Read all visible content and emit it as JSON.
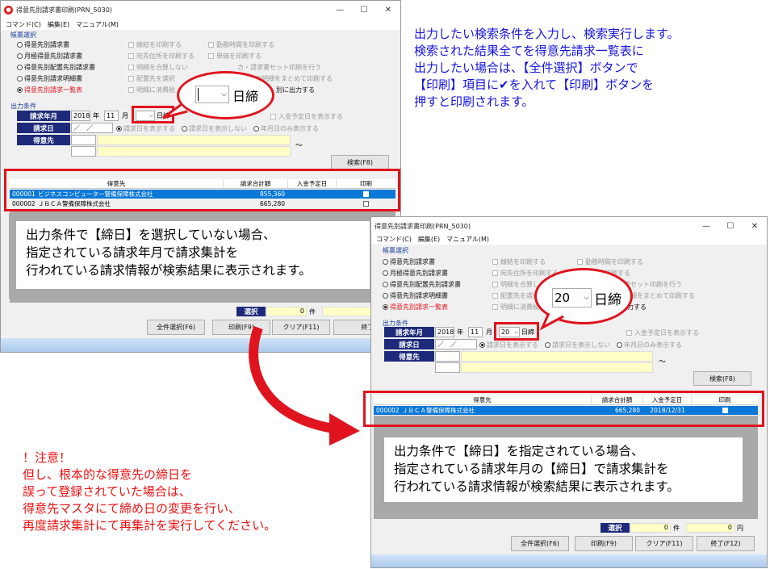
{
  "window": {
    "title": "得意先別請求書印刷(PRN_5030)",
    "menu": [
      "コマンド(C)",
      "編集(E)",
      "マニュアル(M)"
    ],
    "controls": [
      "—",
      "☐",
      "✕"
    ]
  },
  "report_group": {
    "label": "帳票選択",
    "options": [
      "得意先別請求書",
      "月極得意先別請求書",
      "得意先別配置先別請求書",
      "得意先別請求明細書",
      "得意先別請求一覧表"
    ],
    "checks_col1": [
      "線結を印刷する",
      "宛先住所を印刷する",
      "明細を合算しない",
      "配置先を選択",
      "明細に消費税"
    ],
    "checks_col2": [
      "勤務時間を印刷する",
      "単価を印刷する",
      "カ・請求書セット印刷を行う",
      "先の明細をまとめて印刷する",
      "別に出力する"
    ],
    "checks_col2_full": [
      "勤務時間を印刷する",
      "単価を印刷する",
      "請求書セット印刷を行う",
      "先の明細をまとめて印刷する",
      "分別に出力する"
    ]
  },
  "conditions": {
    "label": "出力条件",
    "year_month_label": "請求年月",
    "year": "2018",
    "year_unit": "年",
    "month": "11",
    "month_unit": "月",
    "day_empty": "",
    "day_filled": "20",
    "day_unit": "日締",
    "deposit_check": "入金予定日を表示する",
    "billing_day_label": "請求日",
    "billing_day_value": "／　／",
    "billing_radios": [
      "請求日を表示する",
      "請求日を表示しない",
      "年月日のみ表示する"
    ],
    "customer_label": "得意先",
    "tilde": "～",
    "search_button": "検索(F8)"
  },
  "table": {
    "headers": [
      "得意先",
      "請求合計額",
      "入金予定日",
      "印刷"
    ],
    "rows_top": [
      {
        "code": "000001",
        "name": "ビジネスコンピューター警備保障株式会社",
        "amount": "855,360",
        "date": ""
      },
      {
        "code": "000002",
        "name": "ＪＢＣＡ警備保障株式会社",
        "amount": "665,280",
        "date": ""
      }
    ],
    "rows_bottom": [
      {
        "code": "000002",
        "name": "ＪＢＣＡ警備保障株式会社",
        "amount": "665,280",
        "date": "2018/12/31"
      }
    ]
  },
  "footer": {
    "select_label": "選択",
    "count": "0",
    "count_unit": "件",
    "amount": "0",
    "amount_unit": "円",
    "buttons": [
      "全件選択(F6)",
      "印刷(F9)",
      "クリア(F11)",
      "終了(F12)"
    ],
    "buttons_short": [
      "全件選択(F6)",
      "印刷(F9)",
      "クリア(F11)",
      "終了"
    ]
  },
  "bubble_top": {
    "value": "",
    "unit": "日締"
  },
  "bubble_bottom": {
    "value": "20",
    "unit": "日締"
  },
  "notes": {
    "blue": [
      "出力したい検索条件を入力し、検索実行します。",
      "検索された結果全てを得意先請求一覧表に",
      "出力したい場合は、【全件選択】ボタンで",
      "【印刷】項目に✔を入れて【印刷】ボタンを",
      "押すと印刷されます。"
    ],
    "top_box": [
      "出力条件で【締日】を選択していない場合、",
      "指定されている請求年月で請求集計を",
      "行われている請求情報が検索結果に表示されます。"
    ],
    "bottom_box": [
      "出力条件で【締日】を指定されている場合、",
      "指定されている請求年月の【締日】で請求集計を",
      "行われている請求情報が検索結果に表示されます。"
    ],
    "warning": [
      "！注意！",
      "但し、根本的な得意先の締日を",
      "誤って登録されていた場合は、",
      "得意先マスタにて締め日の変更を行い、",
      "再度請求集計にて再集計を実行してください。"
    ]
  },
  "colors": {
    "accent_red": "#e0141e",
    "note_blue": "#1515e0",
    "navy": "#1d2a7a",
    "select_blue": "#0a78d7"
  }
}
